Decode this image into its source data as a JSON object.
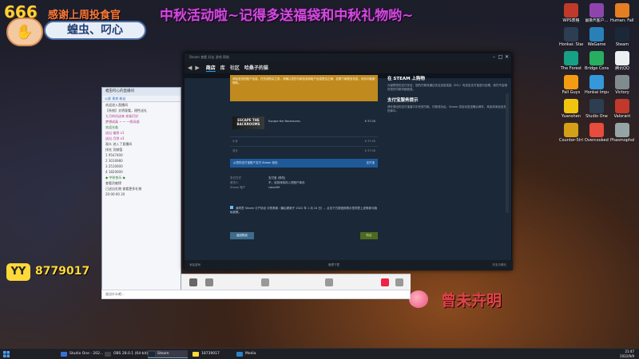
{
  "overlay": {
    "banner": "中秋活动啦~记得多送福袋和中秋礼物哟~",
    "logo_text": "666",
    "thanks_text": "感谢上周投食官",
    "name_card": "蝗虫、叼心",
    "yy_badge": "YY",
    "yy_number": "8779017",
    "signature": "曾未卉明",
    "accent_color": "#d24adf"
  },
  "desktop_icons": [
    {
      "label": "WPS表格",
      "icon": "app-icon",
      "color": "#c0392b"
    },
    {
      "label": "最新Fi客户...",
      "icon": "app-icon",
      "color": "#8e44ad"
    },
    {
      "label": "Human: Fall Flat",
      "icon": "game-icon",
      "color": "#e67e22"
    },
    {
      "label": "Honkai: Star Rail",
      "icon": "game-icon",
      "color": "#2c3e50"
    },
    {
      "label": "WeGame",
      "icon": "app-icon",
      "color": "#2980b9"
    },
    {
      "label": "Steam",
      "icon": "steam-icon",
      "color": "#1b2838"
    },
    {
      "label": "The Forest",
      "icon": "game-icon",
      "color": "#16a085"
    },
    {
      "label": "Bridge Constructor",
      "icon": "game-icon",
      "color": "#27ae60"
    },
    {
      "label": "腾讯QQ",
      "icon": "qq-icon",
      "color": "#ecf0f1"
    },
    {
      "label": "Fall Guys",
      "icon": "game-icon",
      "color": "#f39c12"
    },
    {
      "label": "Honkai Impact",
      "icon": "game-icon",
      "color": "#3498db"
    },
    {
      "label": "Victory",
      "icon": "app-icon",
      "color": "#7f8c8d"
    },
    {
      "label": "Yuanshen",
      "icon": "game-icon",
      "color": "#f1c40f"
    },
    {
      "label": "Studio One",
      "icon": "app-icon",
      "color": "#2c3e50"
    },
    {
      "label": "Valorant",
      "icon": "game-icon",
      "color": "#c0392b"
    },
    {
      "label": "Counter-Strike: Global Off...",
      "icon": "game-icon",
      "color": "#d4a017"
    },
    {
      "label": "Overcooked 2",
      "icon": "game-icon",
      "color": "#e74c3c"
    },
    {
      "label": "Phasmophobia",
      "icon": "game-icon",
      "color": "#95a5a6"
    }
  ],
  "chat": {
    "title": "蝗虫叼心的直播间",
    "tabs": "公屏  贵宾  粉丝",
    "lines": [
      {
        "text": "欢迎进入直播间",
        "style": "normal"
      },
      {
        "text": "【系统】文明观看，理性送礼",
        "style": "normal"
      },
      {
        "text": "九月的风送来 老板们好",
        "style": "hi"
      },
      {
        "text": "梦想成真 ~ ~ 一帆风顺",
        "style": "hi"
      },
      {
        "text": "欢迎光临",
        "style": "alt"
      },
      {
        "text": "送出 福袋 x1",
        "style": "hi"
      },
      {
        "text": "送出 月饼 x3",
        "style": "hi"
      },
      {
        "text": "观众 进入了直播间",
        "style": "normal"
      },
      {
        "text": "排名   贡献值",
        "style": "normal"
      },
      {
        "text": "1    9547400",
        "style": "normal"
      },
      {
        "text": "2    3016980",
        "style": "normal"
      },
      {
        "text": "3    2510000",
        "style": "normal"
      },
      {
        "text": "4    1820000",
        "style": "normal"
      },
      {
        "text": "◆ 中秋快乐 ◆",
        "style": "alt"
      },
      {
        "text": "查看贡献榜",
        "style": "normal"
      },
      {
        "text": "已送出礼物 查看更多礼物",
        "style": "normal"
      },
      {
        "text": "20:00:00 20",
        "style": "normal"
      }
    ],
    "comment_placeholder": "说点什么吧..."
  },
  "steam": {
    "menu": "Steam  查看  好友  游戏  帮助",
    "nav_tabs": [
      {
        "label": "商店",
        "active": true
      },
      {
        "label": "库",
        "active": false
      },
      {
        "label": "社区",
        "active": false
      },
      {
        "label": "哈桑子的猫",
        "active": false
      }
    ],
    "warning_text": "请检查您的账户信息。在完成购买之前，请确认您的付款信息和账户信息是否正确。如需了解更多信息，请访问客服帮助。",
    "game": {
      "thumb_text": "ESCAPE THE BACKROOMS",
      "name": "Escape the Backrooms",
      "price": "¥ 37.00"
    },
    "subtotal_label": "小计",
    "subtotal_value": "¥ 37.00",
    "total_label": "总计",
    "total_value": "¥ 37.00",
    "pay_method": "从您的支付宝账户支付 Steam 钱包",
    "pay_badge": "支付宝",
    "details": [
      {
        "k": "支付方式",
        "v": "支付宝 (修改)"
      },
      {
        "k": "收货人",
        "v": "不，该游戏将存入您账户库存"
      },
      {
        "k": "Steam 账户",
        "v": "catan99"
      }
    ],
    "agree_text": "我同意 Steam 订户协议 中的条款（最后更新于 2022 年 1 月 24 日）。点击下方按钮即表示您同意上述条款与隐私政策。",
    "back_button": "返回购买",
    "buy_button": "购买",
    "sidebar_title": "在 STEAM 上购物",
    "sidebar_text1": "为保障您的支付安全，您的付款将通过安全加密连接（SSL）传送至支付宝进行处理。我们不会储存您的付款详细信息。",
    "sidebar_subtitle": "支付宝服务提示",
    "sidebar_text2": "请在弹出的支付宝窗口中完成付款。付款成功后，Steam 将自动发送确认邮件，商品将添加至您的库中。",
    "footer_left": "添加游戏",
    "footer_mid": "好友与聊天",
    "footer_right": "管理下载"
  },
  "taskbar": {
    "items": [
      {
        "label": "Studio One - 202...",
        "color": "#3a6fd8",
        "active": false
      },
      {
        "label": "OBS 28.0.1 (64-bit)",
        "color": "#444",
        "active": false
      },
      {
        "label": "Steam",
        "color": "#1b2838",
        "active": true
      },
      {
        "label": "18739017",
        "color": "#ffd83a",
        "active": false
      },
      {
        "label": "Media",
        "color": "#2c82c9",
        "active": false
      }
    ],
    "time": "21:47",
    "date": "2022/9/9"
  }
}
